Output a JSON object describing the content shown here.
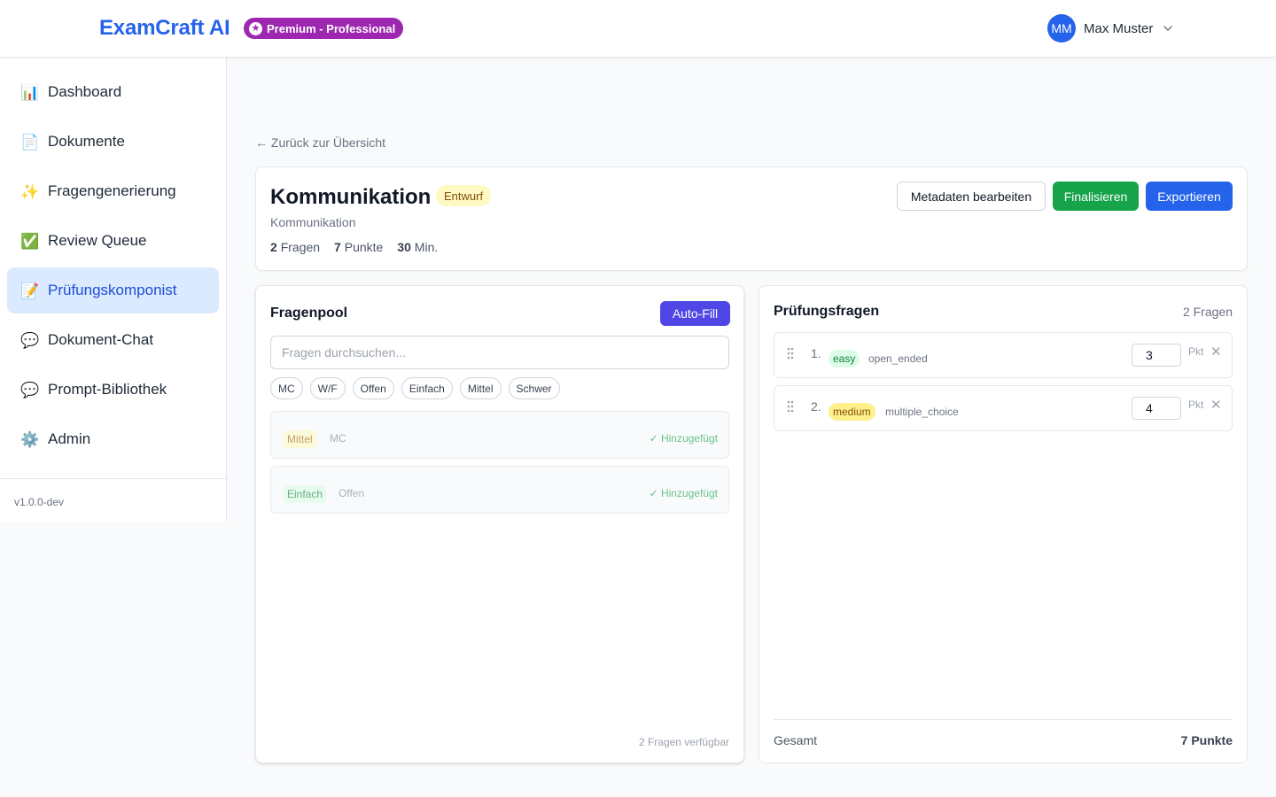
{
  "header": {
    "brand": "ExamCraft AI",
    "plan_badge": "Premium - Professional",
    "user": {
      "initials": "MM",
      "name": "Max Muster"
    }
  },
  "sidebar": {
    "items": [
      {
        "label": "Dashboard",
        "icon": "📊",
        "icon_name": "bar-chart-icon"
      },
      {
        "label": "Dokumente",
        "icon": "📄",
        "icon_name": "document-icon"
      },
      {
        "label": "Fragengenerierung",
        "icon": "✨",
        "icon_name": "sparkles-icon"
      },
      {
        "label": "Review Queue",
        "icon": "✅",
        "icon_name": "check-icon"
      },
      {
        "label": "Prüfungskomponist",
        "icon": "📝",
        "icon_name": "memo-icon",
        "active": true
      },
      {
        "label": "Dokument-Chat",
        "icon": "💬",
        "icon_name": "chat-icon"
      },
      {
        "label": "Prompt-Bibliothek",
        "icon": "💬",
        "icon_name": "chat-icon"
      },
      {
        "label": "Admin",
        "icon": "⚙️",
        "icon_name": "gear-icon"
      }
    ],
    "version": "v1.0.0-dev"
  },
  "main": {
    "back_link": "← Zurück zur Übersicht",
    "exam": {
      "title": "Kommunikation",
      "status": "Entwurf",
      "subtitle": "Kommunikation",
      "stats": {
        "questions_value": "2",
        "questions_label": "Fragen",
        "points_value": "7",
        "points_label": "Punkte",
        "minutes_value": "30",
        "minutes_label": "Min."
      },
      "actions": {
        "edit_meta": "Metadaten bearbeiten",
        "finalize": "Finalisieren",
        "export": "Exportieren"
      }
    },
    "pool": {
      "title": "Fragenpool",
      "autofill": "Auto-Fill",
      "search_placeholder": "Fragen durchsuchen...",
      "filters": [
        "MC",
        "W/F",
        "Offen",
        "Einfach",
        "Mittel",
        "Schwer"
      ],
      "items": [
        {
          "difficulty": "Mittel",
          "type": "MC",
          "status": "✓ Hinzugefügt"
        },
        {
          "difficulty": "Einfach",
          "type": "Offen",
          "status": "✓ Hinzugefügt"
        }
      ],
      "footer": "2 Fragen verfügbar"
    },
    "exam_questions": {
      "title": "Prüfungsfragen",
      "count": "2 Fragen",
      "items": [
        {
          "number": "1.",
          "difficulty": "easy",
          "type": "open_ended",
          "points": "3",
          "unit": "Pkt"
        },
        {
          "number": "2.",
          "difficulty": "medium",
          "type": "multiple_choice",
          "points": "4",
          "unit": "Pkt"
        }
      ],
      "total_label": "Gesamt",
      "total_value": "7 Punkte"
    }
  },
  "colors": {
    "primary": "#2563eb",
    "premium": "#9d27b0",
    "success": "#16a34a",
    "indigo": "#4f46e5",
    "active_nav_bg": "#dbeafe"
  }
}
